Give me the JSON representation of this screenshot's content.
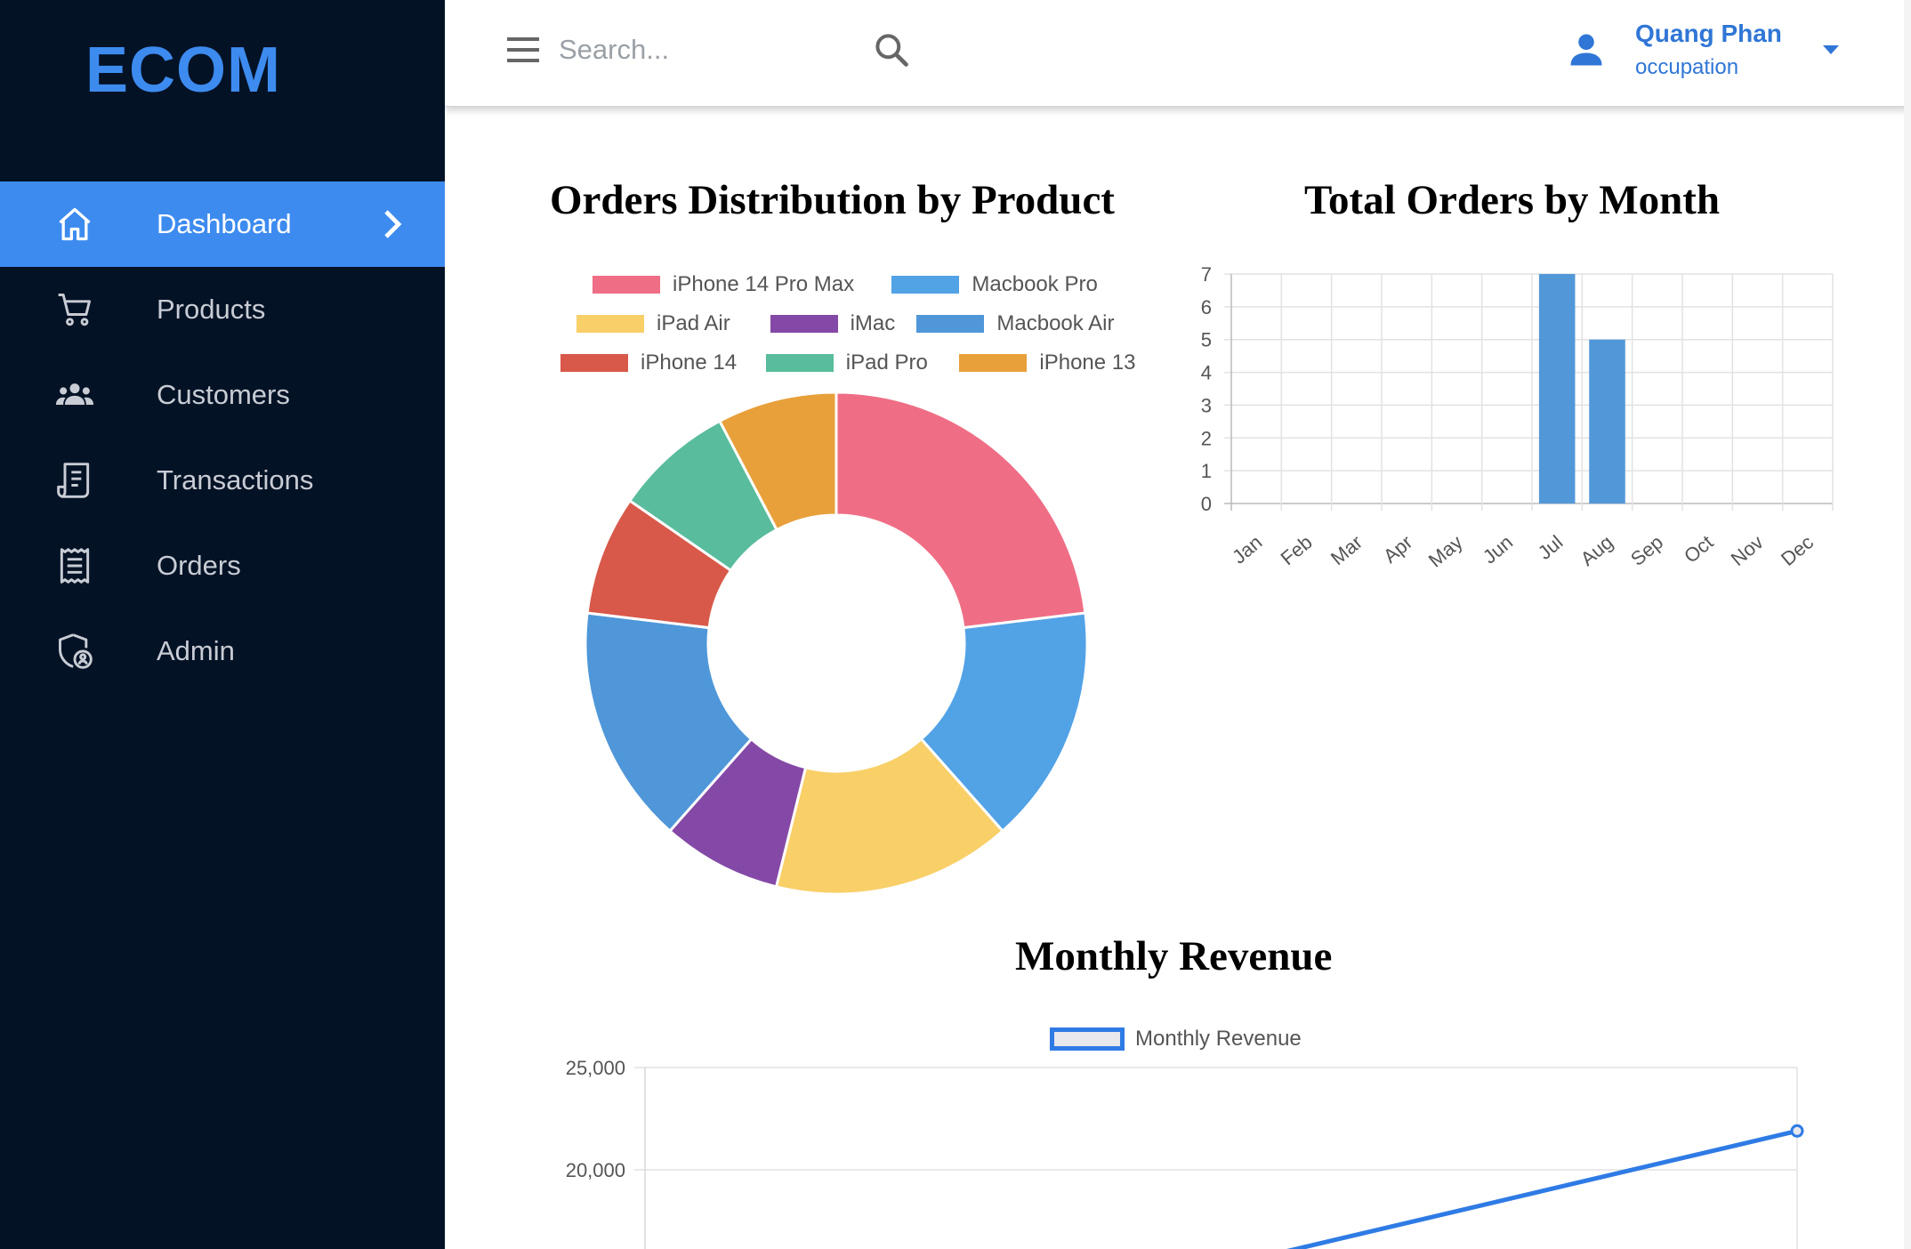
{
  "app": {
    "logo": "ECOM"
  },
  "sidebar": {
    "items": [
      {
        "label": "Dashboard",
        "icon": "home-icon",
        "active": true
      },
      {
        "label": "Products",
        "icon": "cart-icon",
        "active": false
      },
      {
        "label": "Customers",
        "icon": "people-icon",
        "active": false
      },
      {
        "label": "Transactions",
        "icon": "receipt-icon",
        "active": false
      },
      {
        "label": "Orders",
        "icon": "list-icon",
        "active": false
      },
      {
        "label": "Admin",
        "icon": "admin-shield-icon",
        "active": false
      }
    ]
  },
  "header": {
    "search_placeholder": "Search...",
    "user": {
      "name": "Quang Phan",
      "role": "occupation"
    }
  },
  "colors": {
    "sidebar_bg": "#041226",
    "accent": "#3d8bef",
    "user_text": "#2f76d6"
  },
  "chart_data": [
    {
      "type": "pie",
      "title": "Orders Distribution by Product",
      "donut": true,
      "legend_position": "top",
      "categories": [
        "iPhone 14 Pro Max",
        "Macbook Pro",
        "iPad Air",
        "iMac",
        "Macbook Air",
        "iPhone 14",
        "iPad Pro",
        "iPhone 13"
      ],
      "values": [
        3,
        2,
        2,
        1,
        2,
        1,
        1,
        1
      ],
      "colors": [
        "#ef6e85",
        "#52a2e6",
        "#f9cf68",
        "#8449a6",
        "#4f97d8",
        "#d8594a",
        "#58bc9d",
        "#e8a03b"
      ]
    },
    {
      "type": "bar",
      "title": "Total Orders by Month",
      "categories": [
        "Jan",
        "Feb",
        "Mar",
        "Apr",
        "May",
        "Jun",
        "Jul",
        "Aug",
        "Sep",
        "Oct",
        "Nov",
        "Dec"
      ],
      "values": [
        0,
        0,
        0,
        0,
        0,
        0,
        7,
        5,
        0,
        0,
        0,
        0
      ],
      "ylim": [
        0,
        7
      ],
      "yticks": [
        0,
        1,
        2,
        3,
        4,
        5,
        6,
        7
      ],
      "grid": true,
      "color": "#5298d8"
    },
    {
      "type": "line",
      "title": "Monthly Revenue",
      "legend_position": "top",
      "series": [
        {
          "name": "Monthly Revenue",
          "values": [
            21900
          ]
        }
      ],
      "yticks": [
        "25,000",
        "20,000"
      ],
      "grid": true,
      "color": "#2f7be5"
    }
  ]
}
